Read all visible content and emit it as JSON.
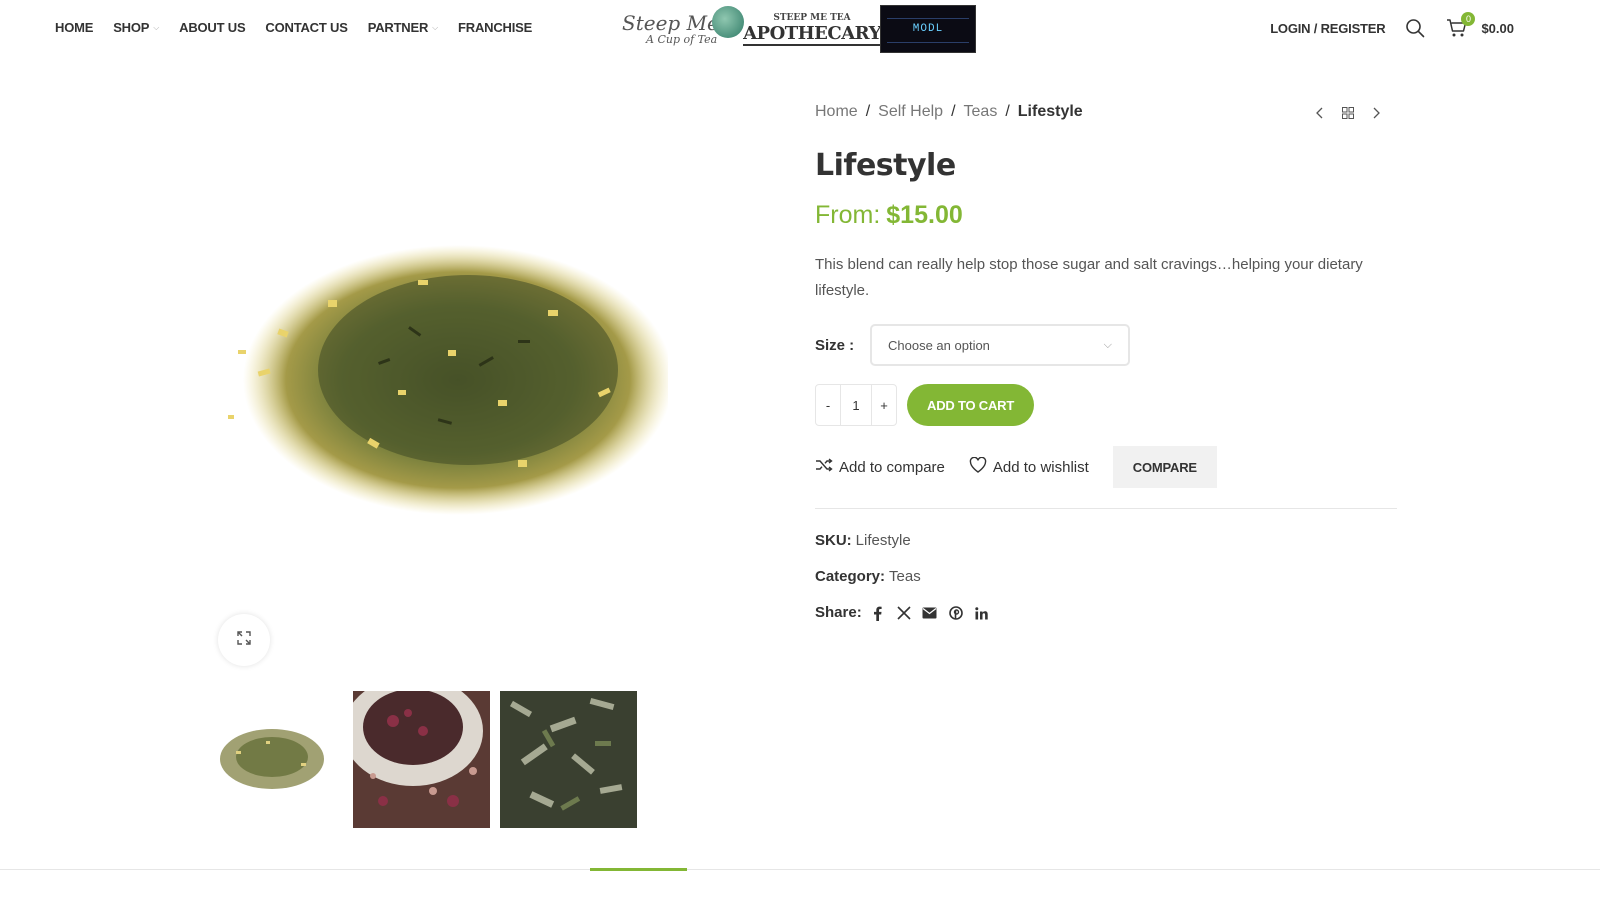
{
  "nav": {
    "items": [
      {
        "label": "HOME",
        "has_dropdown": false
      },
      {
        "label": "SHOP",
        "has_dropdown": true
      },
      {
        "label": "ABOUT US",
        "has_dropdown": false
      },
      {
        "label": "CONTACT US",
        "has_dropdown": false
      },
      {
        "label": "PARTNER",
        "has_dropdown": true
      },
      {
        "label": "FRANCHISE",
        "has_dropdown": false
      }
    ]
  },
  "logos": {
    "steepme": {
      "title": "Steep Me",
      "subtitle": "A Cup of Tea"
    },
    "apothecary": {
      "top": "STEEP ME TEA",
      "main": "APOTHECARY"
    },
    "modl": {
      "text": "MODL"
    }
  },
  "header": {
    "login_label": "LOGIN / REGISTER",
    "cart_count": "0",
    "cart_total": "$0.00"
  },
  "breadcrumb": {
    "items": [
      "Home",
      "Self Help",
      "Teas"
    ],
    "current": "Lifestyle"
  },
  "product": {
    "title": "Lifestyle",
    "price_prefix": "From:",
    "price": "$15.00",
    "description": "This blend can really help stop those sugar and salt cravings…helping your dietary lifestyle.",
    "size_label": "Size",
    "size_placeholder": "Choose an option",
    "quantity": "1",
    "qty_minus": "-",
    "qty_plus": "+",
    "add_to_cart": "ADD TO CART",
    "add_to_compare": "Add to compare",
    "add_to_wishlist": "Add to wishlist",
    "compare_button": "COMPARE"
  },
  "meta": {
    "sku_label": "SKU:",
    "sku_value": "Lifestyle",
    "category_label": "Category:",
    "category_value": "Teas",
    "share_label": "Share:",
    "share_icons": [
      "facebook-icon",
      "x-icon",
      "email-icon",
      "pinterest-icon",
      "linkedin-icon"
    ]
  },
  "colors": {
    "accent": "#83b735",
    "text": "#333333",
    "muted": "#777777",
    "border": "#e6e6e6"
  }
}
